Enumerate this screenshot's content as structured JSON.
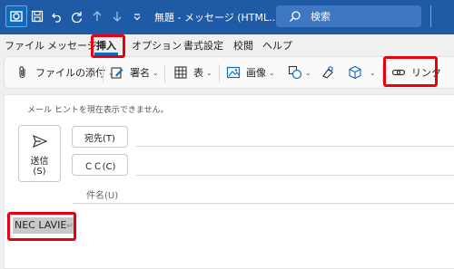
{
  "titlebar": {
    "title": "無題 - メッセージ (HTML...",
    "search_placeholder": "検索",
    "color": "#1f5aa6"
  },
  "quick_access": [
    "save-icon",
    "undo-icon",
    "redo-icon",
    "up-arrow-icon",
    "down-arrow-icon",
    "customize-icon"
  ],
  "menu": {
    "items": [
      "ファイル",
      "メッセージ",
      "挿入",
      "オプション",
      "書式設定",
      "校閲",
      "ヘルプ"
    ],
    "active": "挿入"
  },
  "ribbon": {
    "attach_file": "ファイルの添付",
    "signature": "署名",
    "table": "表",
    "picture": "画像",
    "link": "リンク"
  },
  "compose": {
    "info_text": "メール ヒントを現在表示できません。",
    "send_label_1": "送信",
    "send_label_2": "(S)",
    "to_button": "宛先(T)",
    "cc_button": "ＣＣ(C)",
    "subject_label": "件名(U)",
    "body_text": "NEC LAVIE",
    "body_mark": "↵"
  },
  "highlight_color": "#e60012"
}
